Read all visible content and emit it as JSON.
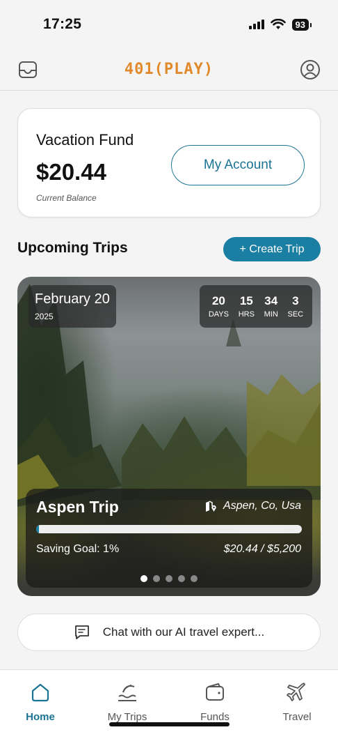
{
  "status_bar": {
    "time": "17:25",
    "battery": "93"
  },
  "header": {
    "logo": "401(PLAY)",
    "brand_color": "#e08a2c"
  },
  "fund": {
    "title": "Vacation Fund",
    "amount": "$20.44",
    "subtitle": "Current Balance",
    "account_button": "My Account"
  },
  "trips": {
    "section_title": "Upcoming Trips",
    "create_button": "+ Create Trip",
    "card": {
      "date": "February 20",
      "year": "2025",
      "countdown": [
        {
          "value": "20",
          "unit": "DAYS"
        },
        {
          "value": "15",
          "unit": "HRS"
        },
        {
          "value": "34",
          "unit": "MIN"
        },
        {
          "value": "3",
          "unit": "SEC"
        }
      ],
      "name": "Aspen Trip",
      "location": "Aspen, Co, Usa",
      "progress": 0.01,
      "saving_goal": "Saving Goal: 1%",
      "saving_amount": "$20.44 / $5,200",
      "pagination": {
        "total": 5,
        "active": 0
      }
    }
  },
  "chat": {
    "placeholder": "Chat with our AI travel expert..."
  },
  "tab_bar": {
    "items": [
      {
        "label": "Home",
        "icon": "home-icon",
        "active": true
      },
      {
        "label": "My Trips",
        "icon": "beach-icon",
        "active": false
      },
      {
        "label": "Funds",
        "icon": "wallet-icon",
        "active": false
      },
      {
        "label": "Travel",
        "icon": "airplane-icon",
        "active": false
      }
    ]
  },
  "colors": {
    "accent": "#1a7393",
    "button": "#1a7fa3"
  }
}
